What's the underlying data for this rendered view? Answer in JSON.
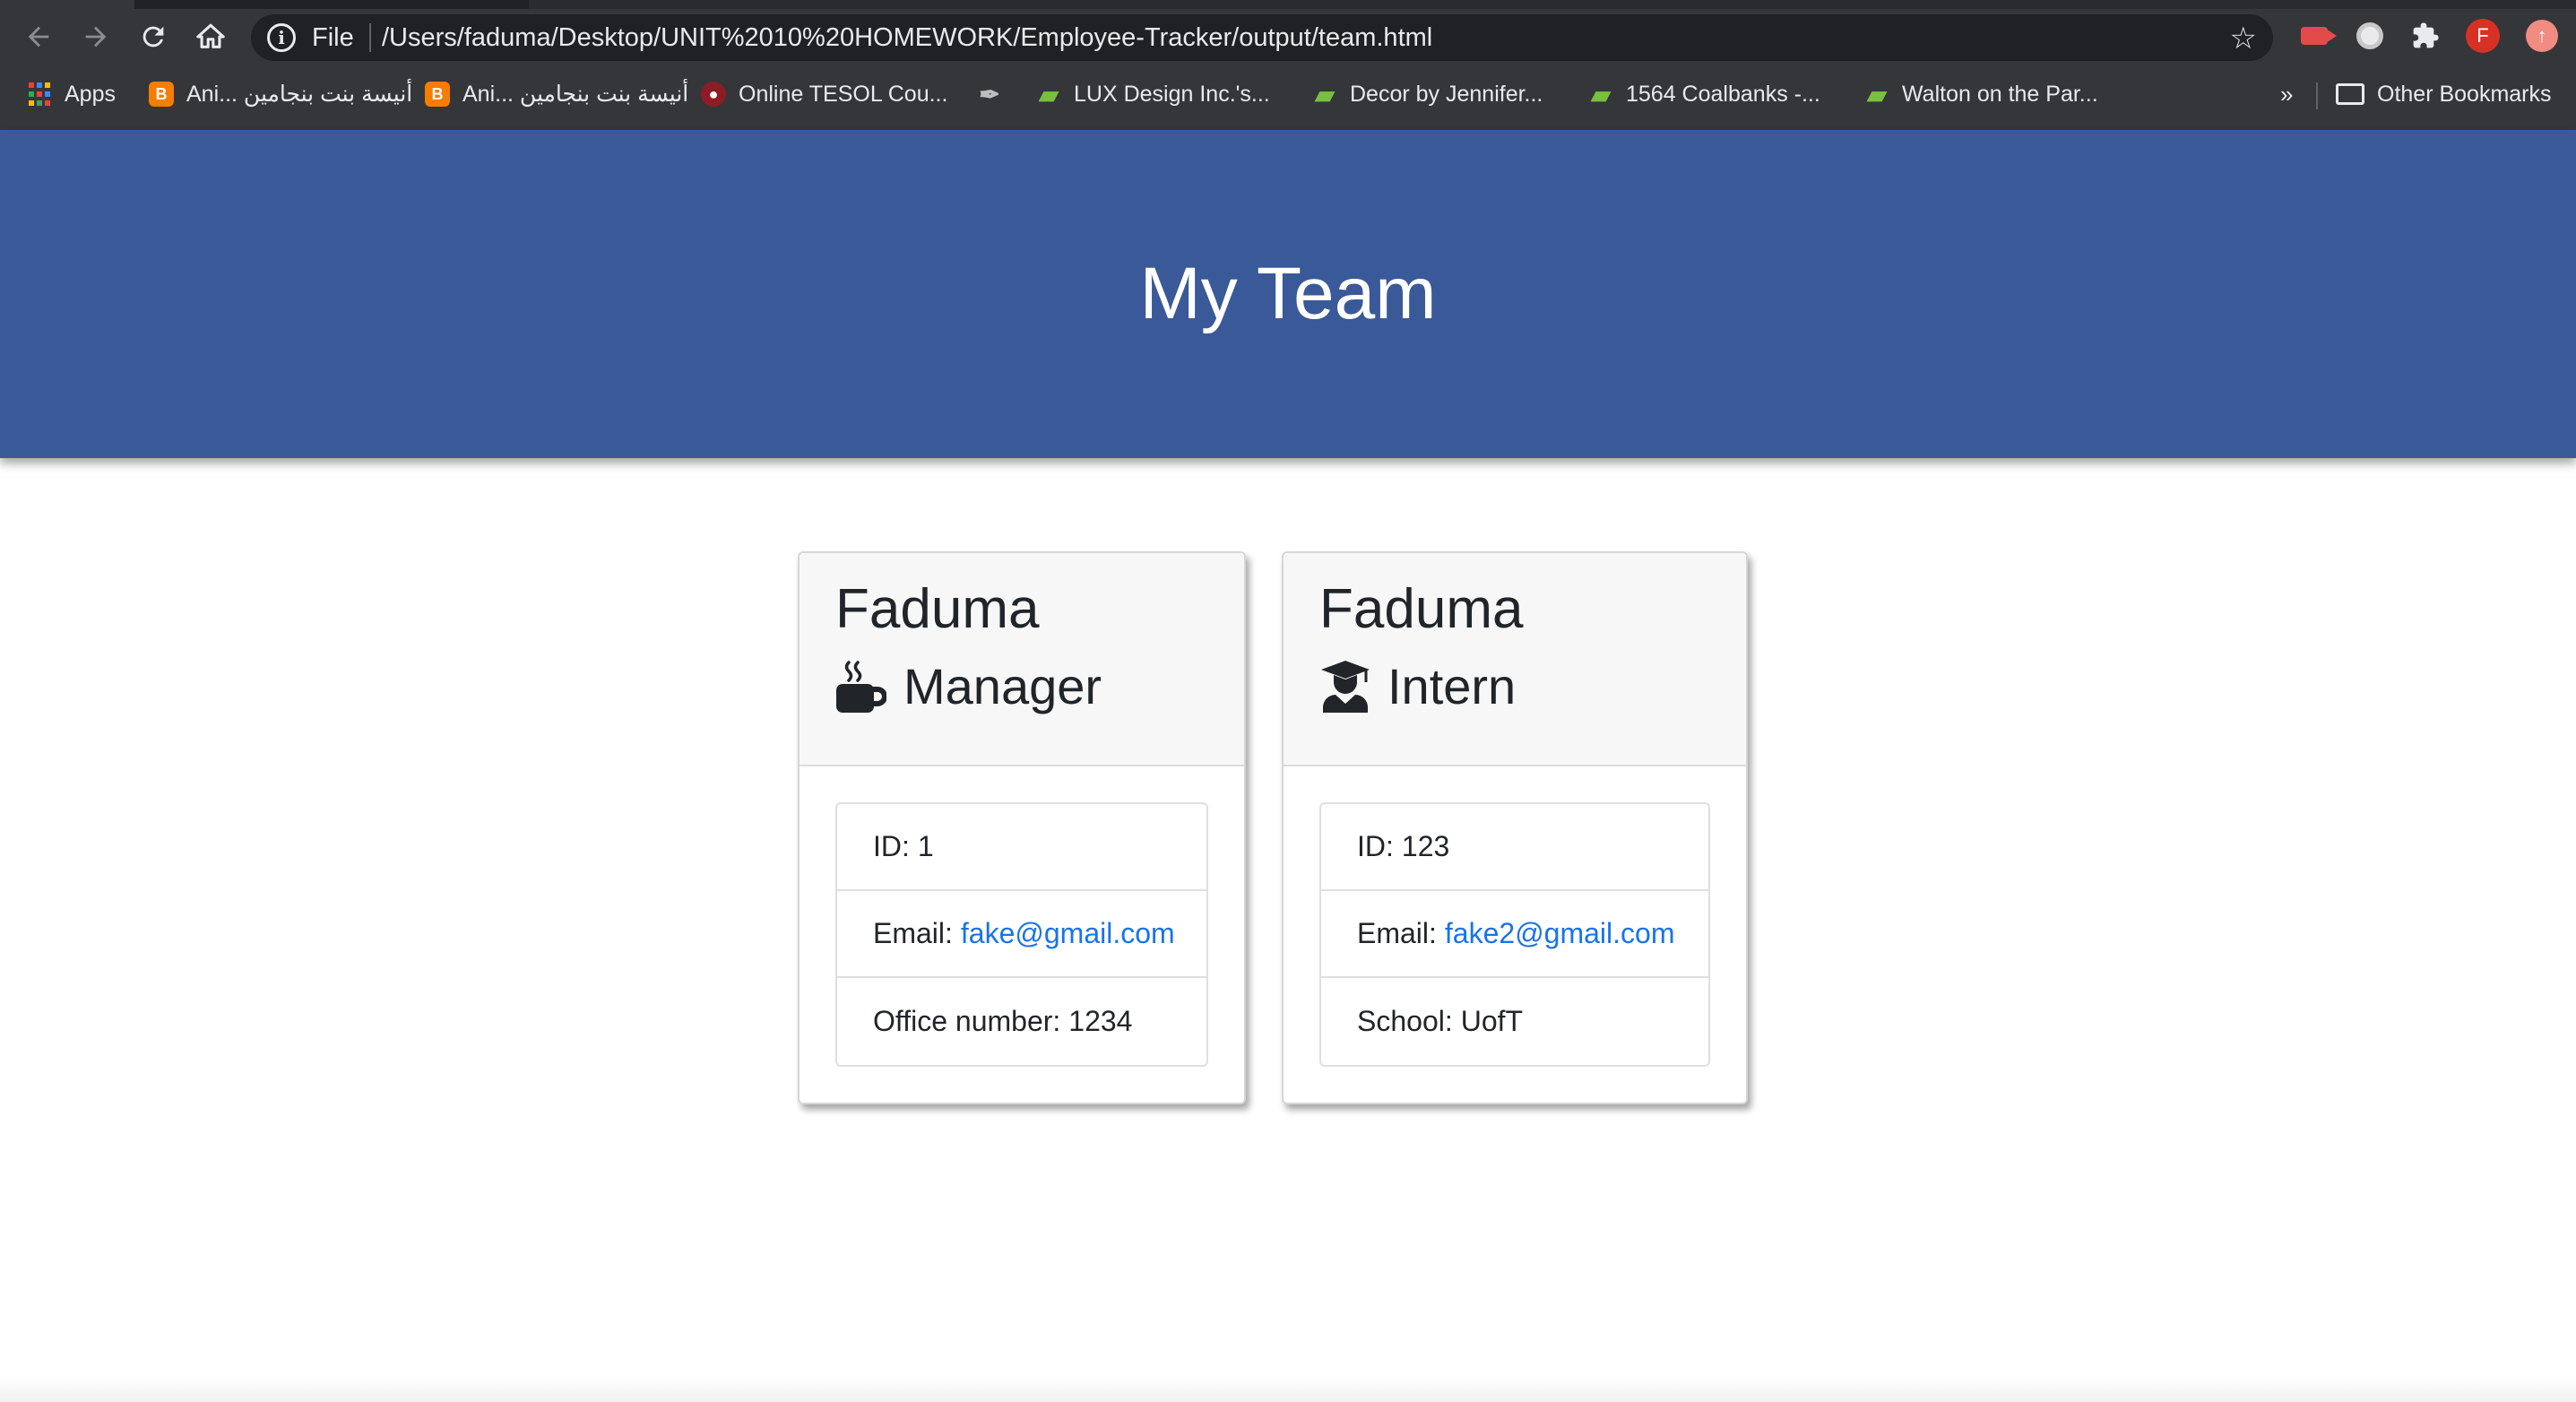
{
  "browser": {
    "url_scheme": "File",
    "url": "/Users/faduma/Desktop/UNIT%2010%20HOMEWORK/Employee-Tracker/output/team.html",
    "avatar_letter": "F",
    "bookmarks": [
      {
        "label": "Apps",
        "icon": "apps-grid-icon"
      },
      {
        "label": "Ani... أنيسة بنت بنجامين",
        "icon": "blogger-icon"
      },
      {
        "label": "Ani... أنيسة بنت بنجامين",
        "icon": "blogger-icon"
      },
      {
        "label": "Online TESOL Cou...",
        "icon": "tesol-icon"
      },
      {
        "label": "",
        "icon": "feather-icon"
      },
      {
        "label": "LUX Design Inc.'s...",
        "icon": "houzz-icon"
      },
      {
        "label": "Decor by Jennifer...",
        "icon": "houzz-icon"
      },
      {
        "label": "1564 Coalbanks -...",
        "icon": "houzz-icon"
      },
      {
        "label": "Walton on the Par...",
        "icon": "houzz-icon"
      }
    ],
    "more_label": "»",
    "other_bookmarks": "Other Bookmarks"
  },
  "page": {
    "title": "My Team",
    "accent_color": "#3a5998",
    "link_color": "#1a73e8",
    "cards": [
      {
        "name": "Faduma",
        "role": "Manager",
        "role_icon": "coffee-mug-icon",
        "items": [
          {
            "label": "ID:",
            "value": "1"
          },
          {
            "label": "Email:",
            "value": "fake@gmail.com",
            "link": true
          },
          {
            "label": "Office number:",
            "value": "1234"
          }
        ]
      },
      {
        "name": "Faduma",
        "role": "Intern",
        "role_icon": "graduate-icon",
        "items": [
          {
            "label": "ID:",
            "value": "123"
          },
          {
            "label": "Email:",
            "value": "fake2@gmail.com",
            "link": true
          },
          {
            "label": "School:",
            "value": "UofT"
          }
        ]
      }
    ]
  }
}
